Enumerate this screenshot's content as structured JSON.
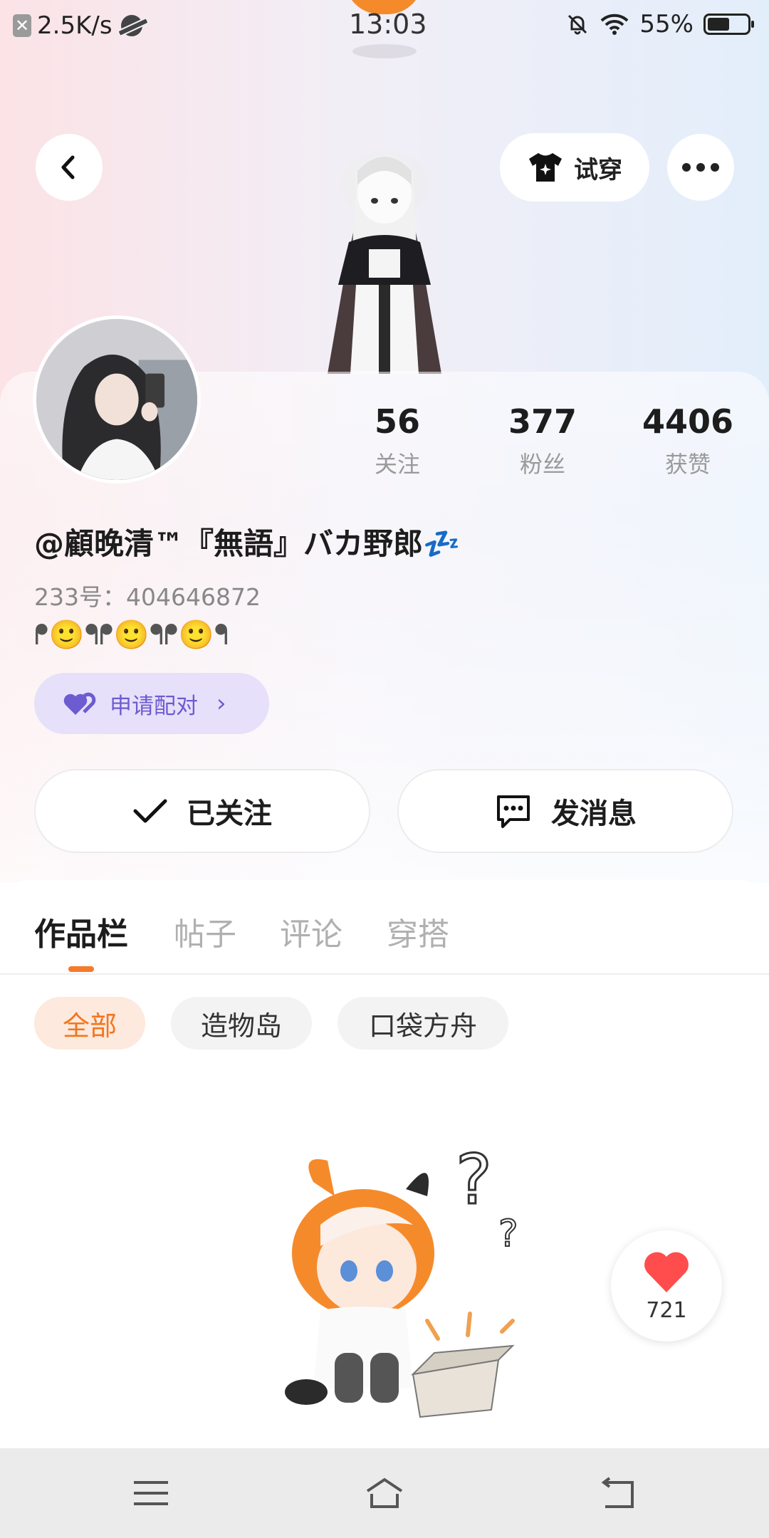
{
  "status_bar": {
    "speed": "2.5K/s",
    "time": "13:03",
    "battery": "55%",
    "battery_level": 0.55
  },
  "header": {
    "try_on_label": "试穿",
    "icons": [
      "back-icon",
      "tshirt-icon",
      "more-icon"
    ]
  },
  "profile": {
    "stats": [
      {
        "value": "56",
        "label": "关注"
      },
      {
        "value": "377",
        "label": "粉丝"
      },
      {
        "value": "4406",
        "label": "获赞"
      }
    ],
    "username": "@顧晚清™『無語』バカ野郎💤",
    "uid": "233号：404646872",
    "bio": "ᖰ🙂ᖳᖰ🙂ᖳᖰ🙂ᖳ",
    "pair_label": "申请配对",
    "follow_label": "已关注",
    "message_label": "发消息"
  },
  "tabs": [
    {
      "label": "作品栏",
      "active": true
    },
    {
      "label": "帖子",
      "active": false
    },
    {
      "label": "评论",
      "active": false
    },
    {
      "label": "穿搭",
      "active": false
    }
  ],
  "filters": [
    {
      "label": "全部",
      "active": true
    },
    {
      "label": "造物岛",
      "active": false
    },
    {
      "label": "口袋方舟",
      "active": false
    }
  ],
  "floating_like": {
    "count": "721"
  },
  "colors": {
    "accent": "#f57a2b",
    "pair_purple": "#6d5bd0",
    "heart_red": "#ff4d4d"
  }
}
